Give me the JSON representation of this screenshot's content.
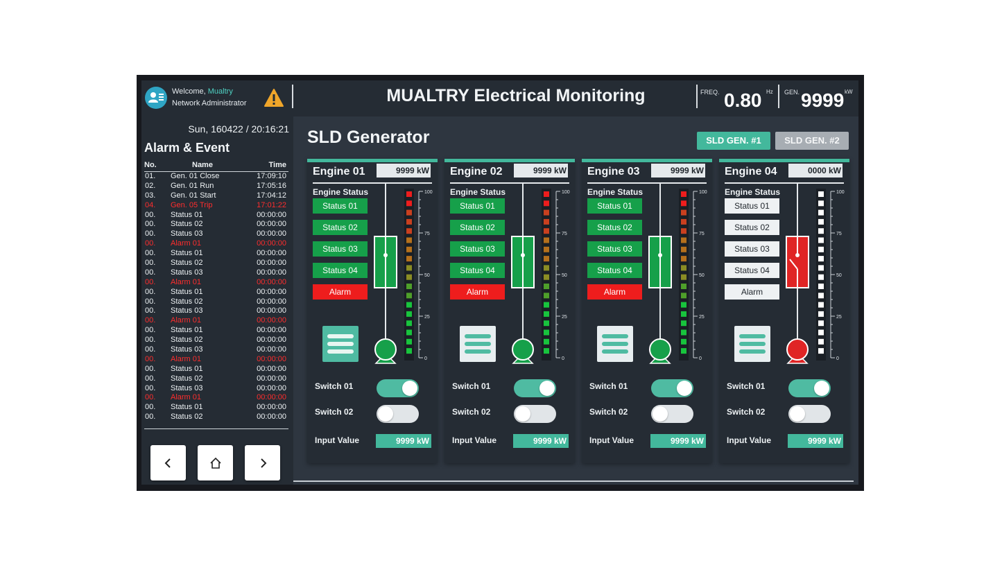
{
  "header": {
    "welcome_prefix": "Welcome,",
    "user_name": "Mualtry",
    "role": "Network Administrator",
    "title": "MUALTRY Electrical Monitoring",
    "freq_label": "FREQ.",
    "freq_value": "0.80",
    "freq_unit": "Hz",
    "gen_label": "GEN.",
    "gen_value": "9999",
    "gen_unit": "kW",
    "warning_icon": "warning-triangle-icon",
    "user_icon": "user-list-icon"
  },
  "sidebar": {
    "datetime": "Sun, 160422 / 20:16:21",
    "title": "Alarm & Event",
    "columns": [
      "No.",
      "Name",
      "Time"
    ],
    "events": [
      {
        "no": "01.",
        "name": "Gen. 01 Close",
        "time": "17:09:10",
        "alarm": false
      },
      {
        "no": "02.",
        "name": "Gen. 01 Run",
        "time": "17:05:16",
        "alarm": false
      },
      {
        "no": "03.",
        "name": "Gen. 01 Start",
        "time": "17:04:12",
        "alarm": false
      },
      {
        "no": "04.",
        "name": "Gen. 05 Trip",
        "time": "17:01:22",
        "alarm": true
      },
      {
        "no": "00.",
        "name": "Status 01",
        "time": "00:00:00",
        "alarm": false
      },
      {
        "no": "00.",
        "name": "Status 02",
        "time": "00:00:00",
        "alarm": false
      },
      {
        "no": "00.",
        "name": "Status 03",
        "time": "00:00:00",
        "alarm": false
      },
      {
        "no": "00.",
        "name": "Alarm 01",
        "time": "00:00:00",
        "alarm": true
      },
      {
        "no": "00.",
        "name": "Status 01",
        "time": "00:00:00",
        "alarm": false
      },
      {
        "no": "00.",
        "name": "Status 02",
        "time": "00:00:00",
        "alarm": false
      },
      {
        "no": "00.",
        "name": "Status 03",
        "time": "00:00:00",
        "alarm": false
      },
      {
        "no": "00.",
        "name": "Alarm 01",
        "time": "00:00:00",
        "alarm": true
      },
      {
        "no": "00.",
        "name": "Status 01",
        "time": "00:00:00",
        "alarm": false
      },
      {
        "no": "00.",
        "name": "Status 02",
        "time": "00:00:00",
        "alarm": false
      },
      {
        "no": "00.",
        "name": "Status 03",
        "time": "00:00:00",
        "alarm": false
      },
      {
        "no": "00.",
        "name": "Alarm 01",
        "time": "00:00:00",
        "alarm": true
      },
      {
        "no": "00.",
        "name": "Status 01",
        "time": "00:00:00",
        "alarm": false
      },
      {
        "no": "00.",
        "name": "Status 02",
        "time": "00:00:00",
        "alarm": false
      },
      {
        "no": "00.",
        "name": "Status 03",
        "time": "00:00:00",
        "alarm": false
      },
      {
        "no": "00.",
        "name": "Alarm 01",
        "time": "00:00:00",
        "alarm": true
      },
      {
        "no": "00.",
        "name": "Status 01",
        "time": "00:00:00",
        "alarm": false
      },
      {
        "no": "00.",
        "name": "Status 02",
        "time": "00:00:00",
        "alarm": false
      },
      {
        "no": "00.",
        "name": "Status 03",
        "time": "00:00:00",
        "alarm": false
      },
      {
        "no": "00.",
        "name": "Alarm 01",
        "time": "00:00:00",
        "alarm": true
      },
      {
        "no": "00.",
        "name": "Status 01",
        "time": "00:00:00",
        "alarm": false
      },
      {
        "no": "00.",
        "name": "Status 02",
        "time": "00:00:00",
        "alarm": false
      }
    ],
    "nav": {
      "prev_icon": "chevron-left-icon",
      "home_icon": "home-icon",
      "next_icon": "chevron-right-icon"
    }
  },
  "main": {
    "title": "SLD Generator",
    "tabs": [
      {
        "label": "SLD GEN. #1",
        "active": true
      },
      {
        "label": "SLD GEN. #2",
        "active": false
      }
    ],
    "engine_status_label": "Engine Status",
    "switch1_label": "Switch 01",
    "switch2_label": "Switch 02",
    "input_label": "Input Value",
    "meter_scale": [
      "100",
      "75",
      "50",
      "25",
      "0"
    ],
    "engines": [
      {
        "name": "Engine 01",
        "kw": "9999 kW",
        "running": true,
        "statuses": [
          "Status 01",
          "Status 02",
          "Status 03",
          "Status 04"
        ],
        "alarm_label": "Alarm",
        "alarm_active": true,
        "switch1": true,
        "switch2": false,
        "input_value": "9999 kW"
      },
      {
        "name": "Engine 02",
        "kw": "9999 kW",
        "running": true,
        "statuses": [
          "Status 01",
          "Status 02",
          "Status 03",
          "Status 04"
        ],
        "alarm_label": "Alarm",
        "alarm_active": true,
        "switch1": true,
        "switch2": false,
        "input_value": "9999 kW"
      },
      {
        "name": "Engine 03",
        "kw": "9999 kW",
        "running": true,
        "statuses": [
          "Status 01",
          "Status 02",
          "Status 03",
          "Status 04"
        ],
        "alarm_label": "Alarm",
        "alarm_active": true,
        "switch1": true,
        "switch2": false,
        "input_value": "9999 kW"
      },
      {
        "name": "Engine 04",
        "kw": "0000 kW",
        "running": false,
        "statuses": [
          "Status 01",
          "Status 02",
          "Status 03",
          "Status 04"
        ],
        "alarm_label": "Alarm",
        "alarm_active": false,
        "switch1": true,
        "switch2": false,
        "input_value": "9999 kW"
      }
    ]
  },
  "colors": {
    "accent": "#43b89c",
    "running_green": "#16a04a",
    "alarm_red": "#ee1d1d",
    "background": "#2e3640",
    "panel": "#252c34"
  }
}
